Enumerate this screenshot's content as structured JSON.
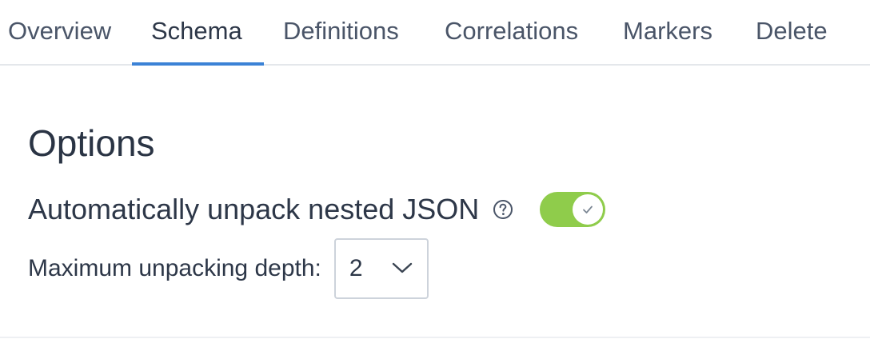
{
  "tabs": [
    {
      "label": "Overview",
      "active": false
    },
    {
      "label": "Schema",
      "active": true
    },
    {
      "label": "Definitions",
      "active": false
    },
    {
      "label": "Correlations",
      "active": false
    },
    {
      "label": "Markers",
      "active": false
    },
    {
      "label": "Delete",
      "active": false
    }
  ],
  "options": {
    "title": "Options",
    "unpack_json": {
      "label": "Automatically unpack nested JSON",
      "help_icon": "question-circle-icon",
      "enabled": true
    },
    "max_depth": {
      "label": "Maximum unpacking depth:",
      "value": "2",
      "icon": "chevron-down-icon"
    }
  },
  "colors": {
    "accent": "#3b82d6",
    "toggle_on": "#8fcc4b",
    "text": "#2d3748"
  }
}
